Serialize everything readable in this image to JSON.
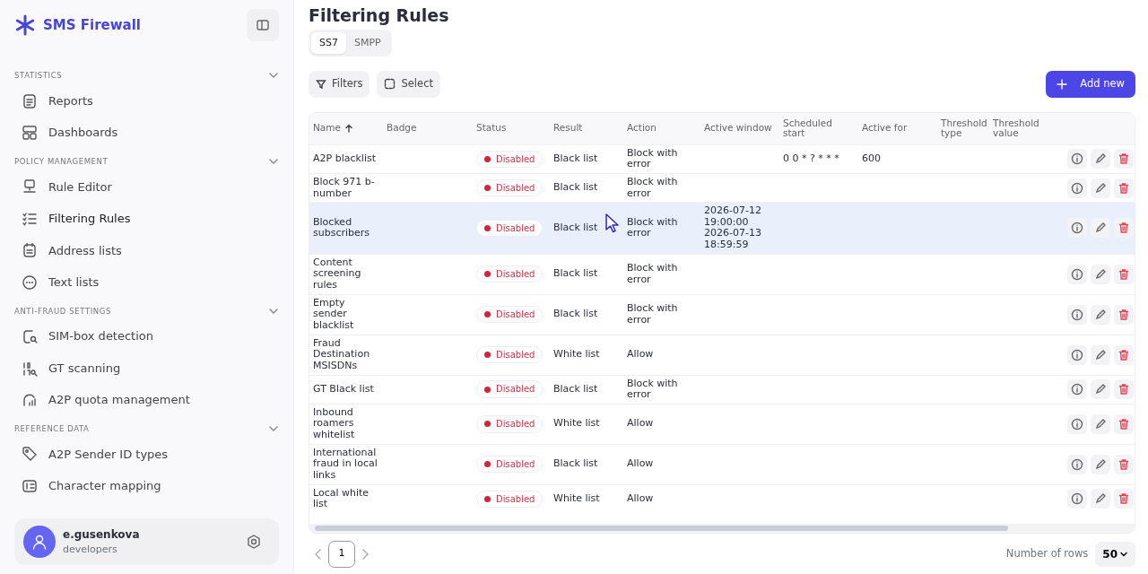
{
  "app": {
    "title": "SMS Firewall"
  },
  "sidebar": {
    "sections": [
      {
        "title": "STATISTICS",
        "expanded": true,
        "items": [
          {
            "label": "Reports",
            "selected": false
          },
          {
            "label": "Dashboards",
            "selected": false
          }
        ]
      },
      {
        "title": "POLICY MANAGEMENT",
        "expanded": true,
        "items": [
          {
            "label": "Rule Editor",
            "selected": false
          },
          {
            "label": "Filtering Rules",
            "selected": true
          },
          {
            "label": "Address lists",
            "selected": false
          },
          {
            "label": "Text lists",
            "selected": false
          }
        ]
      },
      {
        "title": "ANTI-FRAUD SETTINGS",
        "expanded": true,
        "items": [
          {
            "label": "SIM-box detection",
            "selected": false
          },
          {
            "label": "GT scanning",
            "selected": false
          },
          {
            "label": "A2P quota management",
            "selected": false
          }
        ]
      },
      {
        "title": "REFERENCE DATA",
        "expanded": true,
        "items": [
          {
            "label": "A2P Sender ID types",
            "selected": false
          },
          {
            "label": "Character mapping",
            "selected": false
          }
        ]
      }
    ]
  },
  "user": {
    "name": "e.gusenkova",
    "group": "developers"
  },
  "page": {
    "title": "Filtering Rules"
  },
  "tabs": [
    {
      "label": "SS7",
      "selected": true
    },
    {
      "label": "SMPP",
      "selected": false
    }
  ],
  "toolbar": {
    "filters": "Filters",
    "select": "Select",
    "add": "Add new"
  },
  "table": {
    "columns": [
      {
        "label": "Name",
        "sorted": true
      },
      {
        "label": "Badge",
        "sorted": false
      },
      {
        "label": "Status",
        "sorted": false
      },
      {
        "label": "Result",
        "sorted": false
      },
      {
        "label": "Action",
        "sorted": false
      },
      {
        "label": "Active window",
        "sorted": false
      },
      {
        "label": "Scheduled start",
        "sorted": false
      },
      {
        "label": "Active for",
        "sorted": false
      },
      {
        "label": "Threshold type",
        "sorted": false
      },
      {
        "label": "Threshold value",
        "sorted": false
      }
    ],
    "rows": [
      {
        "name": "A2P blacklist",
        "status": "Disabled",
        "enabled": false,
        "result": "Black list",
        "action": "Block with error",
        "scheduled_start": "0 0 * ? * * *",
        "active_for": "600",
        "hovered": false
      },
      {
        "name": "Block 971 b-number",
        "status": "Disabled",
        "enabled": false,
        "result": "Black list",
        "action": "Block with error",
        "hovered": false
      },
      {
        "name": "Blocked subscribers",
        "status": "Disabled",
        "enabled": false,
        "result": "Black list",
        "action": "Block with error",
        "active_window": "2026-07-12 19:00:00 2026-07-13 18:59:59",
        "hovered": true
      },
      {
        "name": "Content screening rules",
        "status": "Disabled",
        "enabled": false,
        "result": "Black list",
        "action": "Block with error",
        "hovered": false
      },
      {
        "name": "Empty sender blacklist",
        "status": "Disabled",
        "enabled": false,
        "result": "Black list",
        "action": "Block with error",
        "hovered": false
      },
      {
        "name": "Fraud Destination MSISDNs",
        "status": "Disabled",
        "enabled": false,
        "result": "White list",
        "action": "Allow",
        "hovered": false
      },
      {
        "name": "GT Black list",
        "status": "Disabled",
        "enabled": false,
        "result": "Black list",
        "action": "Block with error",
        "hovered": false
      },
      {
        "name": "Inbound roamers whitelist",
        "status": "Disabled",
        "enabled": false,
        "result": "White list",
        "action": "Allow",
        "hovered": false
      },
      {
        "name": "International fraud in local links",
        "status": "Disabled",
        "enabled": false,
        "result": "Black list",
        "action": "Allow",
        "hovered": false
      },
      {
        "name": "Local white list",
        "status": "Disabled",
        "enabled": false,
        "result": "White list",
        "action": "Allow",
        "hovered": false
      }
    ]
  },
  "pagination": {
    "pages": [
      {
        "label": "1",
        "selected": true
      }
    ],
    "rows_label": "Number of rows",
    "rows_value": "50"
  }
}
